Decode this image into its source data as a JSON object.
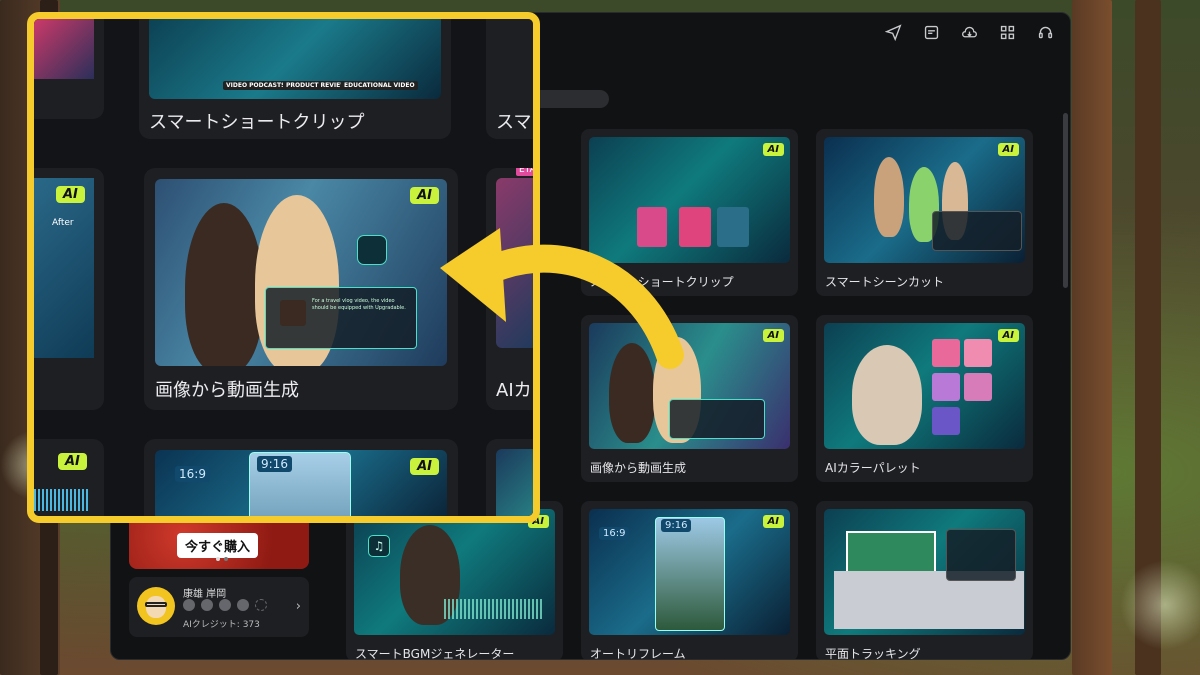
{
  "app": {
    "top_icons": [
      "send-icon",
      "feedback-icon",
      "cloud-icon",
      "grid-icon",
      "headset-icon"
    ],
    "cards": [
      {
        "label": "スマートショートクリップ",
        "badge": "AI",
        "tags": [
          "VIDEO PODCASTS",
          "PRODUCT REVIEWS",
          "EDUCATIONAL VIDEO"
        ]
      },
      {
        "label": "スマートシーンカット",
        "badge": "AI"
      },
      {
        "label": "画像から動画生成",
        "badge": "AI"
      },
      {
        "label": "AIカラーパレット",
        "badge": "AI"
      },
      {
        "label": "スマートBGMジェネレーター",
        "badge": "AI"
      },
      {
        "label": "オートリフレーム",
        "badge": "AI",
        "ratio_small": "16:9",
        "ratio_large": "9:16"
      },
      {
        "label": "平面トラッキング",
        "badge": ""
      }
    ],
    "left_panel": {
      "buy_button": "今すぐ購入",
      "user_name": "康雄 岸岡",
      "ai_credits": "AIクレジット: 373"
    }
  },
  "zoom": {
    "top_card_label": "スマートショートクリップ",
    "top_card_label_cut": "スマ",
    "top_tags": [
      "VIDEO PODCASTS",
      "PRODUCT REVIEWS",
      "EDUCATIONAL VIDEO"
    ],
    "main_card_label": "画像から動画生成",
    "side_card_label_cut": "AIカ",
    "beta_badge": "ETA",
    "after_label": "After",
    "badge": "AI",
    "ratio_small": "16:9",
    "ratio_large": "9:16",
    "prompt_text": "For a travel vlog video, the video should be equipped with Upgradable."
  },
  "colors": {
    "highlight": "#f6cc2c",
    "ai_badge": "#c8f23c",
    "window_bg": "#111214"
  }
}
